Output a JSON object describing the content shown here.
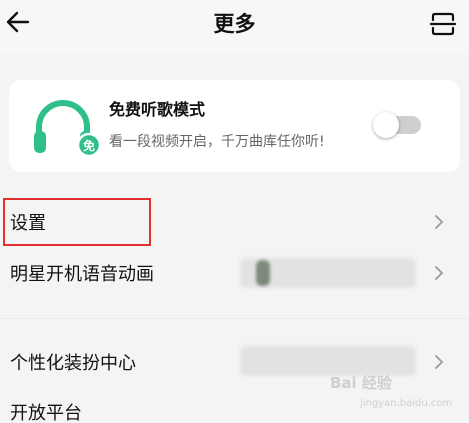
{
  "header": {
    "title": "更多",
    "back_icon": "arrow-left-icon",
    "right_icon": "scan-icon"
  },
  "free_mode_card": {
    "title": "免费听歌模式",
    "subtitle": "看一段视频开启，千万曲库任你听!",
    "icon": "headphone-icon",
    "badge": "免",
    "toggle_on": false,
    "accent": "#2fc08a"
  },
  "menu": {
    "items": [
      {
        "label": "设置"
      },
      {
        "label": "明星开机语音动画"
      },
      {
        "label": "个性化装扮中心"
      },
      {
        "label": "开放平台"
      }
    ]
  },
  "annotation": {
    "highlight_color": "#e03030"
  },
  "watermark": {
    "brand": "Bai 经验",
    "url": "jingyan.baidu.com"
  }
}
